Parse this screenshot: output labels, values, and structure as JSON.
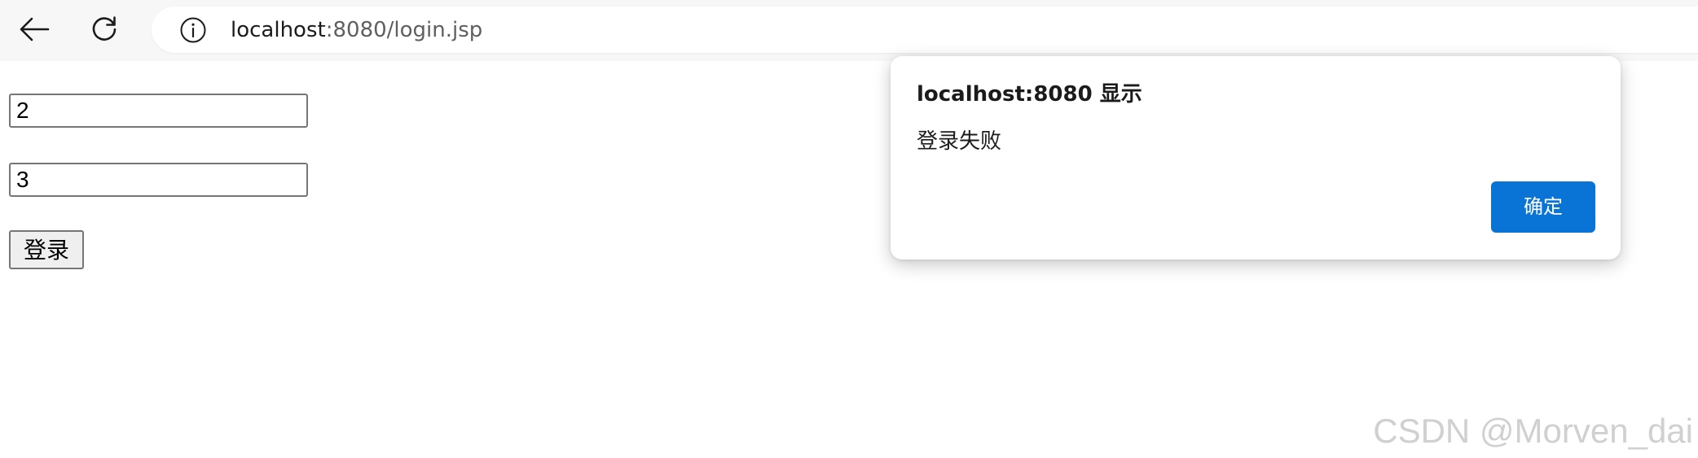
{
  "browser": {
    "address_bar": {
      "url_host": "localhost",
      "url_rest": ":8080/login.jsp"
    },
    "icons": {
      "back": "arrow-left-icon",
      "reload": "reload-icon",
      "info": "info-circle-icon"
    }
  },
  "form": {
    "username_value": "2",
    "password_value": "3",
    "login_button_label": "登录"
  },
  "alert": {
    "title": "localhost:8080 显示",
    "message": "登录失败",
    "ok_button_label": "确定",
    "button_color": "#0a74d6"
  },
  "watermark": {
    "text": "CSDN @Morven_dai"
  }
}
